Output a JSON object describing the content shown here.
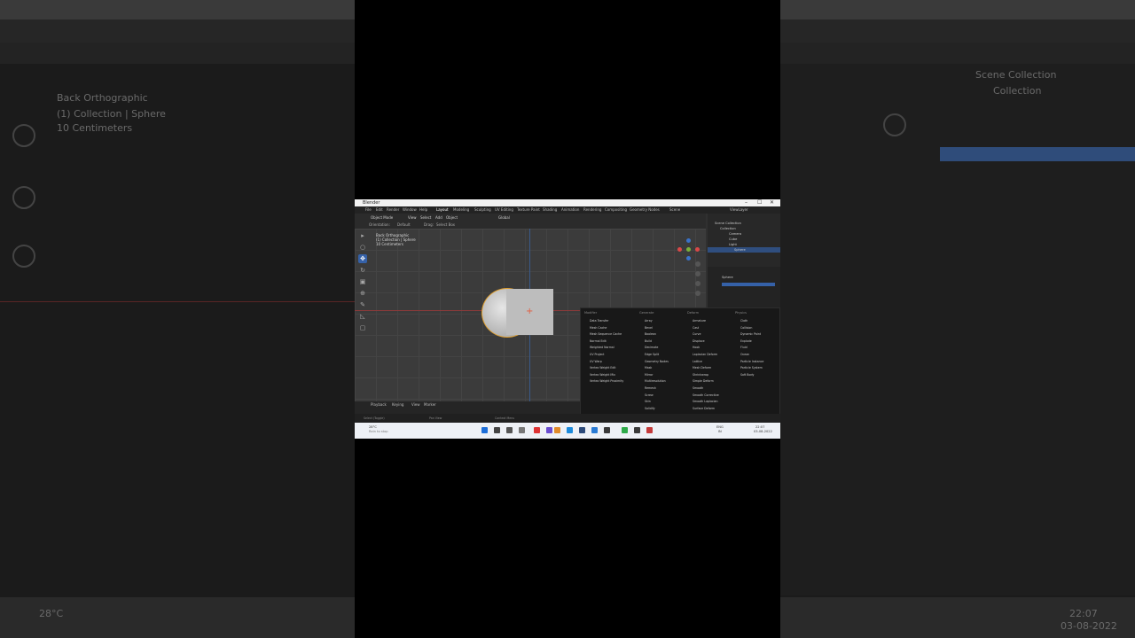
{
  "window": {
    "title": "Blender",
    "controls": [
      "–",
      "☐",
      "✕"
    ]
  },
  "menubar": {
    "items": [
      "File",
      "Edit",
      "Render",
      "Window",
      "Help"
    ],
    "workspaces": [
      "Layout",
      "Modeling",
      "Sculpting",
      "UV Editing",
      "Texture Paint",
      "Shading",
      "Animation",
      "Rendering",
      "Compositing",
      "Geometry Nodes"
    ],
    "scene": "Scene",
    "view_layer": "ViewLayer"
  },
  "toolbar": {
    "mode": "Object Mode",
    "items": [
      "View",
      "Select",
      "Add",
      "Object"
    ],
    "transform": "Global"
  },
  "subbar": {
    "orientation_label": "Orientation:",
    "orientation_value": "Default",
    "drag_label": "Drag:",
    "drag_value": "Select Box"
  },
  "viewport": {
    "info_line1": "Back Orthographic",
    "info_line2": "(1) Collection | Sphere",
    "info_line3": "10 Centimeters"
  },
  "outliner": {
    "root": "Scene Collection",
    "collection": "Collection",
    "items": [
      "Camera",
      "Cube",
      "Light",
      "Sphere"
    ]
  },
  "properties": {
    "object_name": "Sphere"
  },
  "add_menu": {
    "columns": [
      {
        "header": "Modifier",
        "items": [
          "Data Transfer",
          "Mesh Cache",
          "Mesh Sequence Cache",
          "Normal Edit",
          "Weighted Normal",
          "UV Project",
          "UV Warp",
          "Vertex Weight Edit",
          "Vertex Weight Mix",
          "Vertex Weight Proximity"
        ]
      },
      {
        "header": "Generate",
        "items": [
          "Array",
          "Bevel",
          "Boolean",
          "Build",
          "Decimate",
          "Edge Split",
          "Geometry Nodes",
          "Mask",
          "Mirror",
          "Multiresolution",
          "Remesh",
          "Screw",
          "Skin",
          "Solidify"
        ]
      },
      {
        "header": "Deform",
        "items": [
          "Armature",
          "Cast",
          "Curve",
          "Displace",
          "Hook",
          "Laplacian Deform",
          "Lattice",
          "Mesh Deform",
          "Shrinkwrap",
          "Simple Deform",
          "Smooth",
          "Smooth Corrective",
          "Smooth Laplacian",
          "Surface Deform"
        ]
      },
      {
        "header": "Physics",
        "items": [
          "Cloth",
          "Collision",
          "Dynamic Paint",
          "Explode",
          "Fluid",
          "Ocean",
          "Particle Instance",
          "Particle System",
          "Soft Body"
        ]
      }
    ]
  },
  "timeline": {
    "items": [
      "Playback",
      "Keying",
      "View",
      "Marker"
    ]
  },
  "statusbar": {
    "left": "Select (Toggle)",
    "middle": "Pan View",
    "right": "Context Menu"
  },
  "taskbar": {
    "weather_temp": "28°C",
    "weather_desc": "Rain to stop",
    "lang": "ENG",
    "lang2": "IN",
    "time": "22:07",
    "date": "03-08-2022"
  },
  "colors": {
    "accent": "#3561a8",
    "selection": "#2f4e7f",
    "object_outline": "#e0a030"
  }
}
